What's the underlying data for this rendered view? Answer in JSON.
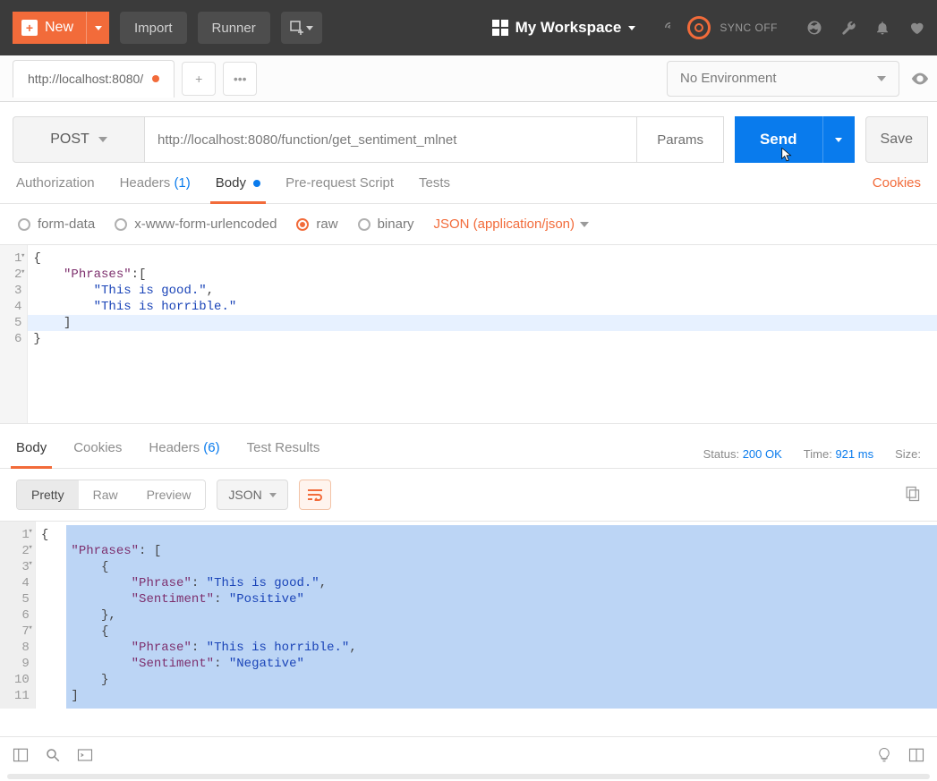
{
  "toolbar": {
    "new_label": "New",
    "import_label": "Import",
    "runner_label": "Runner",
    "workspace_label": "My Workspace",
    "sync_label": "SYNC OFF"
  },
  "environment": {
    "selected": "No Environment"
  },
  "tab": {
    "title": "http://localhost:8080/"
  },
  "request": {
    "method": "POST",
    "url": "http://localhost:8080/function/get_sentiment_mlnet",
    "params_label": "Params",
    "send_label": "Send",
    "save_label": "Save"
  },
  "req_tabs": {
    "authorization": "Authorization",
    "headers": "Headers",
    "headers_count": "(1)",
    "body": "Body",
    "prerequest": "Pre-request Script",
    "tests": "Tests",
    "cookies": "Cookies"
  },
  "body_types": {
    "form_data": "form-data",
    "urlencoded": "x-www-form-urlencoded",
    "raw": "raw",
    "binary": "binary",
    "content_type": "JSON (application/json)"
  },
  "req_body_lines": [
    {
      "n": "1",
      "fold": true,
      "segs": [
        {
          "t": "{",
          "c": "punc"
        }
      ]
    },
    {
      "n": "2",
      "fold": true,
      "segs": [
        {
          "t": "    ",
          "c": "punc"
        },
        {
          "t": "\"Phrases\"",
          "c": "key"
        },
        {
          "t": ":[",
          "c": "punc"
        }
      ]
    },
    {
      "n": "3",
      "segs": [
        {
          "t": "        ",
          "c": "punc"
        },
        {
          "t": "\"This is good.\"",
          "c": "str"
        },
        {
          "t": ",",
          "c": "punc"
        }
      ]
    },
    {
      "n": "4",
      "segs": [
        {
          "t": "        ",
          "c": "punc"
        },
        {
          "t": "\"This is horrible.\"",
          "c": "str"
        }
      ]
    },
    {
      "n": "5",
      "hl": true,
      "segs": [
        {
          "t": "    ]",
          "c": "punc"
        }
      ]
    },
    {
      "n": "6",
      "segs": [
        {
          "t": "}",
          "c": "punc"
        }
      ]
    }
  ],
  "resp_tabs": {
    "body": "Body",
    "cookies": "Cookies",
    "headers": "Headers",
    "headers_count": "(6)",
    "tests": "Test Results"
  },
  "resp_meta": {
    "status_label": "Status:",
    "status_value": "200 OK",
    "time_label": "Time:",
    "time_value": "921 ms",
    "size_label": "Size:"
  },
  "resp_toolbar": {
    "pretty": "Pretty",
    "raw": "Raw",
    "preview": "Preview",
    "format": "JSON"
  },
  "resp_body_lines": [
    {
      "n": "1",
      "fold": true,
      "segs": [
        {
          "t": "{",
          "c": "punc"
        }
      ]
    },
    {
      "n": "2",
      "fold": true,
      "segs": [
        {
          "t": "    ",
          "c": "punc"
        },
        {
          "t": "\"Phrases\"",
          "c": "key"
        },
        {
          "t": ": [",
          "c": "punc"
        }
      ]
    },
    {
      "n": "3",
      "fold": true,
      "segs": [
        {
          "t": "        {",
          "c": "punc"
        }
      ]
    },
    {
      "n": "4",
      "segs": [
        {
          "t": "            ",
          "c": "punc"
        },
        {
          "t": "\"Phrase\"",
          "c": "key"
        },
        {
          "t": ": ",
          "c": "punc"
        },
        {
          "t": "\"This is good.\"",
          "c": "str"
        },
        {
          "t": ",",
          "c": "punc"
        }
      ]
    },
    {
      "n": "5",
      "segs": [
        {
          "t": "            ",
          "c": "punc"
        },
        {
          "t": "\"Sentiment\"",
          "c": "key"
        },
        {
          "t": ": ",
          "c": "punc"
        },
        {
          "t": "\"Positive\"",
          "c": "str"
        }
      ]
    },
    {
      "n": "6",
      "segs": [
        {
          "t": "        },",
          "c": "punc"
        }
      ]
    },
    {
      "n": "7",
      "fold": true,
      "segs": [
        {
          "t": "        {",
          "c": "punc"
        }
      ]
    },
    {
      "n": "8",
      "segs": [
        {
          "t": "            ",
          "c": "punc"
        },
        {
          "t": "\"Phrase\"",
          "c": "key"
        },
        {
          "t": ": ",
          "c": "punc"
        },
        {
          "t": "\"This is horrible.\"",
          "c": "str"
        },
        {
          "t": ",",
          "c": "punc"
        }
      ]
    },
    {
      "n": "9",
      "segs": [
        {
          "t": "            ",
          "c": "punc"
        },
        {
          "t": "\"Sentiment\"",
          "c": "key"
        },
        {
          "t": ": ",
          "c": "punc"
        },
        {
          "t": "\"Negative\"",
          "c": "str"
        }
      ]
    },
    {
      "n": "10",
      "segs": [
        {
          "t": "        }",
          "c": "punc"
        }
      ]
    },
    {
      "n": "11",
      "segs": [
        {
          "t": "    ]",
          "c": "punc"
        }
      ]
    }
  ]
}
